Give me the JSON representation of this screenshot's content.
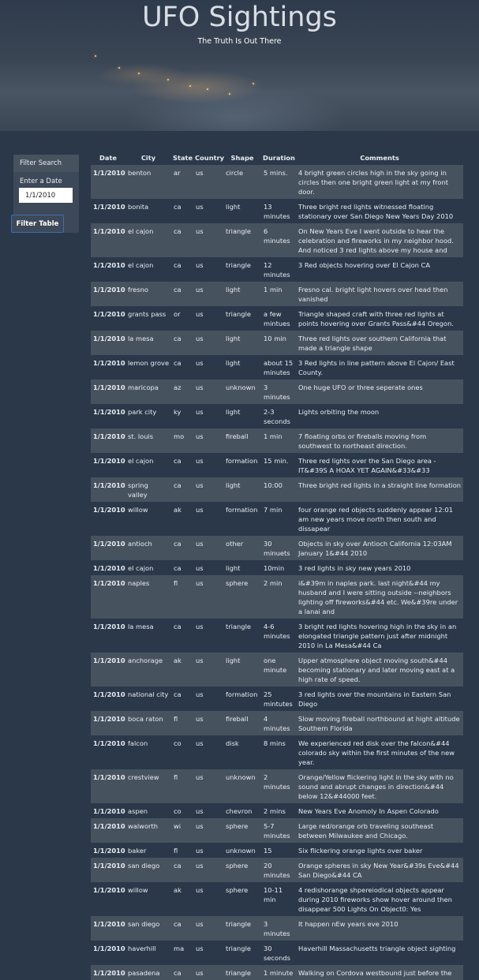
{
  "header": {
    "title": "UFO Sightings",
    "subtitle": "The Truth Is Out There"
  },
  "filter": {
    "heading": "Filter Search",
    "date_label": "Enter a Date",
    "date_value": "1/1/2010",
    "button_label": "Filter Table"
  },
  "table": {
    "columns": [
      "Date",
      "City",
      "State",
      "Country",
      "Shape",
      "Duration",
      "Comments"
    ],
    "rows": [
      [
        "1/1/2010",
        "benton",
        "ar",
        "us",
        "circle",
        "5 mins.",
        "4 bright green circles high in the sky going in circles then one bright green light at my front door."
      ],
      [
        "1/1/2010",
        "bonita",
        "ca",
        "us",
        "light",
        "13 minutes",
        "Three bright red lights witnessed floating stationary over San Diego New Years Day 2010"
      ],
      [
        "1/1/2010",
        "el cajon",
        "ca",
        "us",
        "triangle",
        "6 minutes",
        "On New Years Eve I went outside to hear the celebration and fireworks in my neighbor hood. And noticed 3 red lights above my house and"
      ],
      [
        "1/1/2010",
        "el cajon",
        "ca",
        "us",
        "triangle",
        "12 minutes",
        "3 Red objects hovering over El Cajon CA"
      ],
      [
        "1/1/2010",
        "fresno",
        "ca",
        "us",
        "light",
        "1 min",
        "Fresno cal. bright light hovers over head then vanished"
      ],
      [
        "1/1/2010",
        "grants pass",
        "or",
        "us",
        "triangle",
        "a few mintues",
        "Triangle shaped craft with three red lights at points hovering over Grants Pass&#44 Oregon."
      ],
      [
        "1/1/2010",
        "la mesa",
        "ca",
        "us",
        "light",
        "10 min",
        "Three red lights over southern California that made a triangle shape"
      ],
      [
        "1/1/2010",
        "lemon grove",
        "ca",
        "us",
        "light",
        "about 15 minutes",
        "3 Red lights in line pattern above El Cajon/ East County."
      ],
      [
        "1/1/2010",
        "maricopa",
        "az",
        "us",
        "unknown",
        "3 minutes",
        "One huge UFO or three seperate ones"
      ],
      [
        "1/1/2010",
        "park city",
        "ky",
        "us",
        "light",
        "2-3 seconds",
        "Lights orbiting the moon"
      ],
      [
        "1/1/2010",
        "st. louis",
        "mo",
        "us",
        "fireball",
        "1 min",
        "7 floating orbs or fireballs moving from southwest to northeast direction."
      ],
      [
        "1/1/2010",
        "el cajon",
        "ca",
        "us",
        "formation",
        "15 min.",
        "Three red lights over the San Diego area - IT&#39S A HOAX YET AGAIN&#33&#33"
      ],
      [
        "1/1/2010",
        "spring valley",
        "ca",
        "us",
        "light",
        "10:00",
        "Three bright red lights in a straight line formation"
      ],
      [
        "1/1/2010",
        "willow",
        "ak",
        "us",
        "formation",
        "7 min",
        "four orange red objects suddenly appear 12:01 am new years move north then south and dissapear"
      ],
      [
        "1/1/2010",
        "antioch",
        "ca",
        "us",
        "other",
        "30 minuets",
        "Objects in sky over Antioch California 12:03AM January 1&#44 2010"
      ],
      [
        "1/1/2010",
        "el cajon",
        "ca",
        "us",
        "light",
        "10min",
        "3 red lights in sky new years 2010"
      ],
      [
        "1/1/2010",
        "naples",
        "fl",
        "us",
        "sphere",
        "2 min",
        "i&#39m in naples park. last night&#44 my husband and I were sitting outside --neighbors lighting off fireworks&#44 etc. We&#39re under a lanai and"
      ],
      [
        "1/1/2010",
        "la mesa",
        "ca",
        "us",
        "triangle",
        "4-6 minutes",
        "3 bright red lights hovering high in the sky in an elongated triangle pattern just after midnight 2010 in La Mesa&#44 Ca"
      ],
      [
        "1/1/2010",
        "anchorage",
        "ak",
        "us",
        "light",
        "one minute",
        "Upper atmosphere object moving south&#44 becoming stationary and later moving east at a high rate of speed."
      ],
      [
        "1/1/2010",
        "national city",
        "ca",
        "us",
        "formation",
        "25 mintutes",
        "3 red lights over the mountains in Eastern San Diego"
      ],
      [
        "1/1/2010",
        "boca raton",
        "fl",
        "us",
        "fireball",
        "4 minutes",
        "Slow moving fireball northbound at hight altitude Southern Florida"
      ],
      [
        "1/1/2010",
        "falcon",
        "co",
        "us",
        "disk",
        "8 mins",
        "We experienced red disk over the falcon&#44 colorado sky within the first minutes of the new year."
      ],
      [
        "1/1/2010",
        "crestview",
        "fl",
        "us",
        "unknown",
        "2 minutes",
        "Orange/Yellow flickering light in the sky with no sound and abrupt changes in direction&#44 below 12&#44000 feet."
      ],
      [
        "1/1/2010",
        "aspen",
        "co",
        "us",
        "chevron",
        "2 mins",
        "New Years Eve Anomoly In Aspen Colorado"
      ],
      [
        "1/1/2010",
        "walworth",
        "wi",
        "us",
        "sphere",
        "5-7 minutes",
        "Large red/orange orb traveling southeast between Milwaukee and Chicago."
      ],
      [
        "1/1/2010",
        "baker",
        "fl",
        "us",
        "unknown",
        "15",
        "Six flickering orange lights over baker"
      ],
      [
        "1/1/2010",
        "san diego",
        "ca",
        "us",
        "sphere",
        "20 minutes",
        "Orange spheres in sky New Year&#39s Eve&#44 San Diego&#44 CA"
      ],
      [
        "1/1/2010",
        "willow",
        "ak",
        "us",
        "sphere",
        "10-11 min",
        "4 redishorange shpereiodical objects appear during 2010 fireworks show hover around then disappear 500 Lights On Object0: Yes"
      ],
      [
        "1/1/2010",
        "san diego",
        "ca",
        "us",
        "triangle",
        "3 minutes",
        "It happen nEw years eve 2010"
      ],
      [
        "1/1/2010",
        "haverhill",
        "ma",
        "us",
        "triangle",
        "30 seconds",
        "Haverhill Massachusetts triangle object sighting"
      ],
      [
        "1/1/2010",
        "pasadena",
        "ca",
        "us",
        "triangle",
        "1 minute",
        "Walking on Cordova westbound just before the"
      ]
    ]
  }
}
